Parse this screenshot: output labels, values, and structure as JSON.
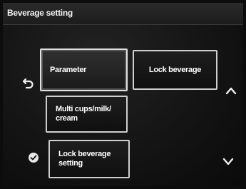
{
  "header": {
    "title": "Beverage setting"
  },
  "buttons": {
    "parameter": "Parameter",
    "lock_beverage": "Lock beverage",
    "multi_line1": "Multi cups/milk/",
    "multi_line2": "cream",
    "lock_setting_line1": "Lock beverage",
    "lock_setting_line2": "setting"
  },
  "icons": {
    "back": "back-arrow-icon",
    "check": "check-icon",
    "scroll_up": "chevron-up-icon",
    "scroll_down": "chevron-down-icon"
  },
  "colors": {
    "background": "#0c0c0c",
    "button_border": "#cfcfcf",
    "text": "#ffffff"
  }
}
